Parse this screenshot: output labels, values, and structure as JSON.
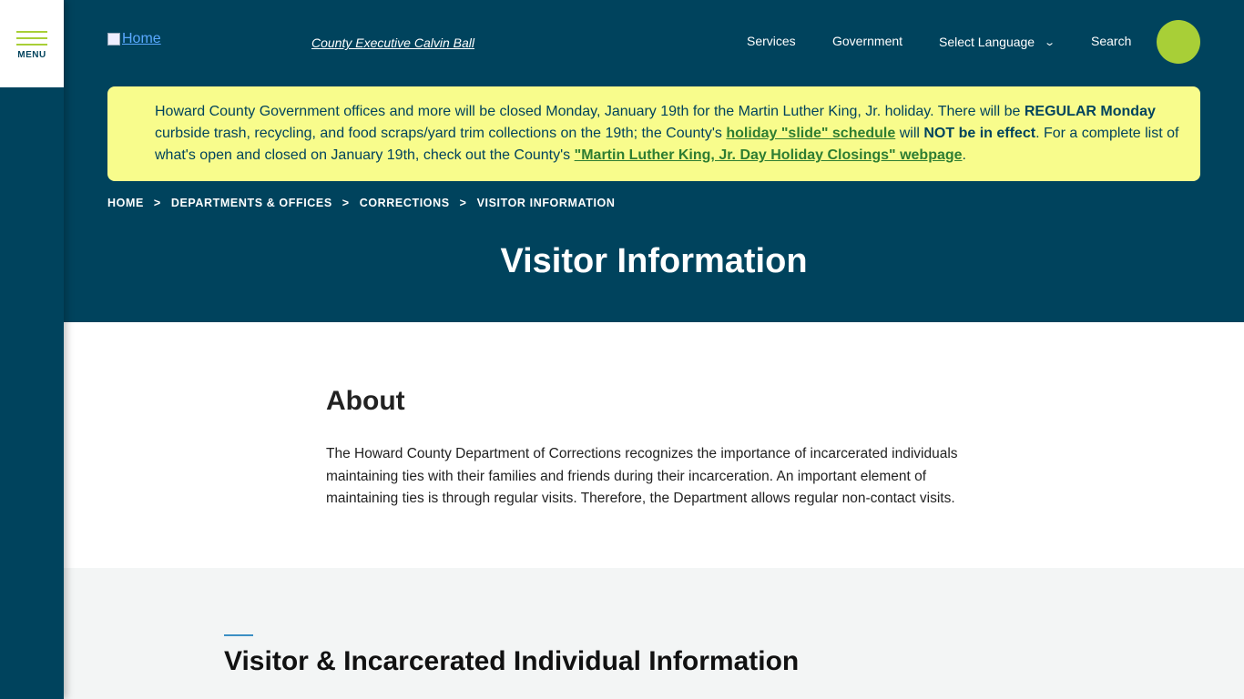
{
  "menu": {
    "label": "MENU"
  },
  "header": {
    "home_link": "Home",
    "executive_link": "County Executive Calvin Ball",
    "nav": {
      "services": "Services",
      "government": "Government",
      "language": "Select Language",
      "search": "Search"
    }
  },
  "alert": {
    "part1": "Howard County Government offices and more will be closed Monday, January 19th for the Martin Luther King, Jr. holiday. There will be ",
    "bold1": "REGULAR Monday",
    "part2": " curbside trash, recycling, and food scraps/yard trim collections on the 19th; the County's ",
    "link1": "holiday \"slide\" schedule",
    "part3": " will ",
    "bold2": "NOT be in effect",
    "part4": ". For a complete list of what's open and closed on January 19th, check out the County's ",
    "link2": "\"Martin Luther King, Jr. Day Holiday Closings\" webpage",
    "part5": "."
  },
  "breadcrumb": {
    "items": [
      "HOME",
      "DEPARTMENTS & OFFICES",
      "CORRECTIONS",
      "VISITOR INFORMATION"
    ],
    "separator": ">"
  },
  "page": {
    "title": "Visitor Information"
  },
  "about": {
    "heading": "About",
    "body": "The Howard County Department of Corrections recognizes the importance of incarcerated individuals maintaining ties with their families and friends during their incarceration.  An important element of maintaining ties is through regular visits.  Therefore, the Department allows regular non-contact visits."
  },
  "visitor_section": {
    "heading": "Visitor & Incarcerated Individual Information"
  },
  "colors": {
    "brand": "#00435d",
    "accent_green": "#a8cf37",
    "alert_bg": "#f8fc8c",
    "link_green": "#2e7d32"
  }
}
